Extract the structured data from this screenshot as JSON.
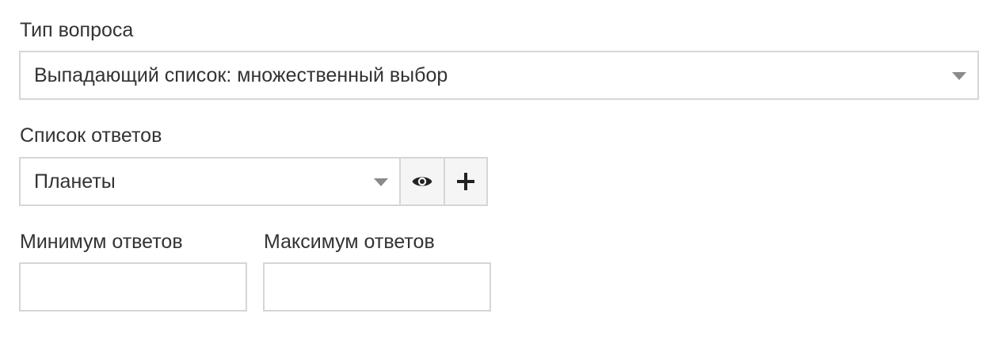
{
  "question_type": {
    "label": "Тип вопроса",
    "selected": "Выпадающий список: множественный выбор"
  },
  "answer_list": {
    "label": "Список ответов",
    "selected": "Планеты",
    "buttons": {
      "preview": "eye-icon",
      "add": "plus-icon"
    }
  },
  "min_answers": {
    "label": "Минимум ответов",
    "value": ""
  },
  "max_answers": {
    "label": "Максимум ответов",
    "value": ""
  },
  "colors": {
    "border": "#d6d6d6",
    "text": "#333333",
    "caret": "#8a8a8a",
    "addon_bg": "#f5f5f5"
  }
}
